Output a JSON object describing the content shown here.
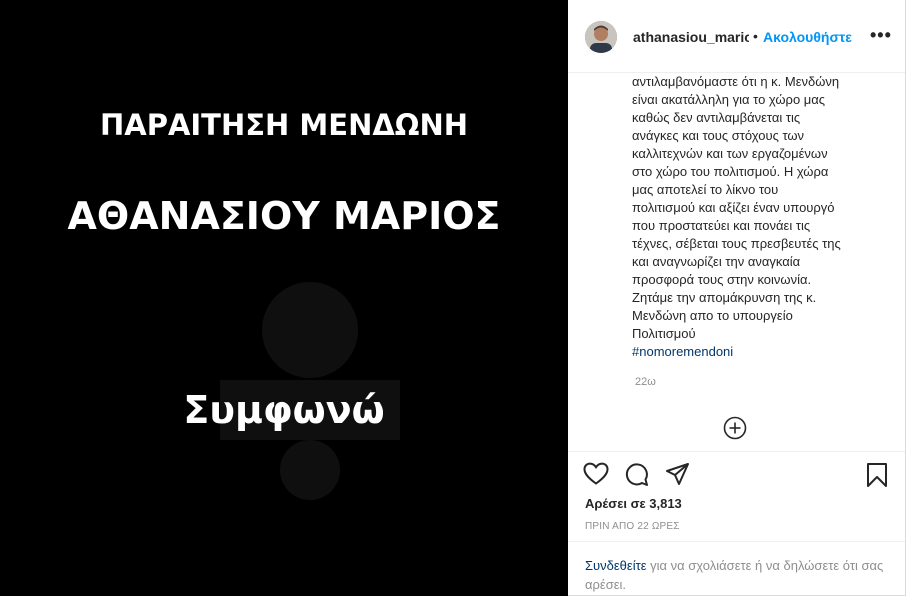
{
  "post_image": {
    "line1": "ΠΑΡΑΙΤΗΣΗ ΜΕΝΔΩΝΗ",
    "line2": "ΑΘΑΝΑΣΙΟΥ ΜΑΡΙΟΣ",
    "line3": "Συμφωνώ"
  },
  "header": {
    "username": "athanasiou_marios",
    "separator": "•",
    "follow_label": "Ακολουθήστε",
    "more_label": "•••"
  },
  "caption": {
    "lines": [
      "αντιλαμβανόμαστε ότι η κ. Μενδώνη",
      "είναι ακατάλληλη για το χώρο μας",
      "καθώς δεν αντιλαμβάνεται τις",
      "ανάγκες και τους στόχους των",
      "καλλιτεχνών και των εργαζομένων",
      "στο χώρο του πολιτισμού. Η χώρα",
      "μας αποτελεί το λίκνο του",
      "πολιτισμού και αξίζει έναν υπουργό",
      "που προστατεύει και πονάει τις",
      "τέχνες, σέβεται τους πρεσβευτές της",
      "και αναγνωρίζει την αναγκαία",
      "προσφορά τους στην κοινωνία.",
      "Ζητάμε την απομάκρυνση της κ.",
      "Μενδώνη απο το υπουργείο",
      "Πολιτισμού"
    ],
    "hashtag": "#nomoremendoni",
    "time": "22ω"
  },
  "actions": {
    "likes": "Αρέσει σε 3,813",
    "ago": "ΠΡΙΝ ΑΠΟ 22 ΩΡΕΣ"
  },
  "login": {
    "link": "Συνδεθείτε",
    "text": " για να σχολιάσετε ή να δηλώσετε ότι σας αρέσει."
  },
  "icons": [
    "plus-circle-icon",
    "heart-icon",
    "comment-icon",
    "share-icon",
    "bookmark-icon"
  ],
  "colors": {
    "accent": "#0095f6",
    "link": "#00376b",
    "muted": "#8e8e8e",
    "text": "#262626"
  }
}
